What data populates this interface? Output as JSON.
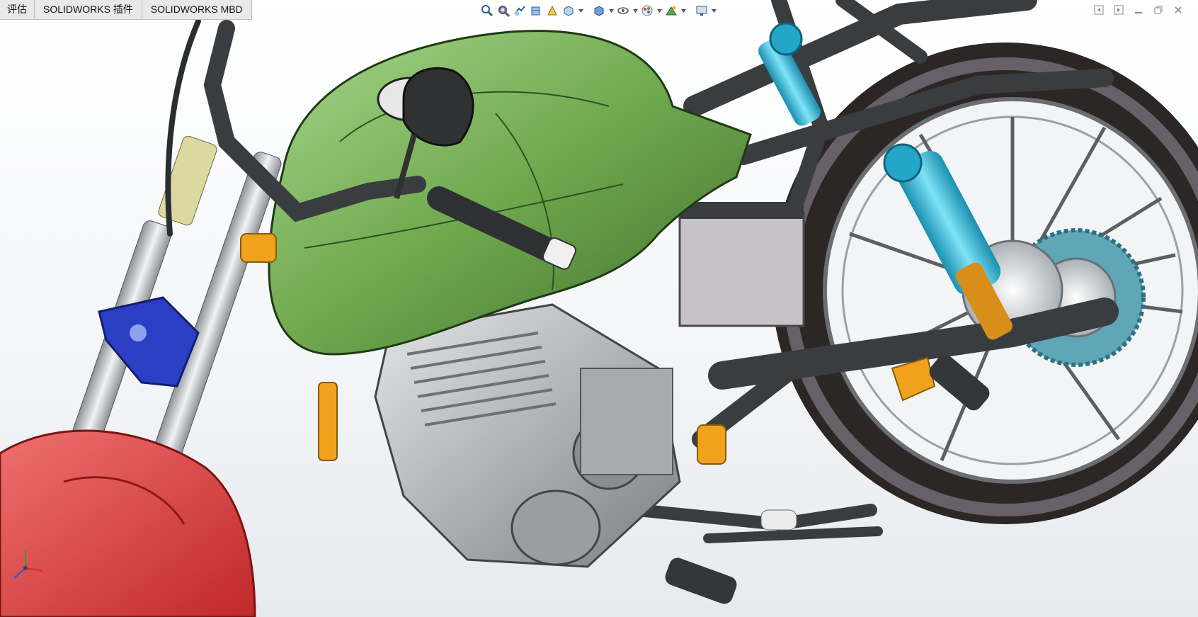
{
  "command_manager": {
    "tabs": [
      {
        "label": "评估"
      },
      {
        "label": "SOLIDWORKS 插件"
      },
      {
        "label": "SOLIDWORKS MBD"
      }
    ]
  },
  "heads_up_toolbar": {
    "icons": [
      "zoom-to-fit-icon",
      "zoom-to-area-icon",
      "previous-view-icon",
      "section-view-icon",
      "dynamic-annotation-icon",
      "view-orientation-icon",
      "display-style-icon",
      "hide-show-items-icon",
      "edit-appearance-icon",
      "apply-scene-icon",
      "view-settings-icon"
    ]
  },
  "colors": {
    "fuel_tank": "#6fa84e",
    "front_fender": "#e04040",
    "shock_spring": "#29b7d6",
    "frame": "#3a3d40",
    "tire": "#2c2624",
    "engine": "#b9bcbf",
    "accent_orange": "#f0a21e",
    "triple_clamp": "#2a3fc4"
  }
}
